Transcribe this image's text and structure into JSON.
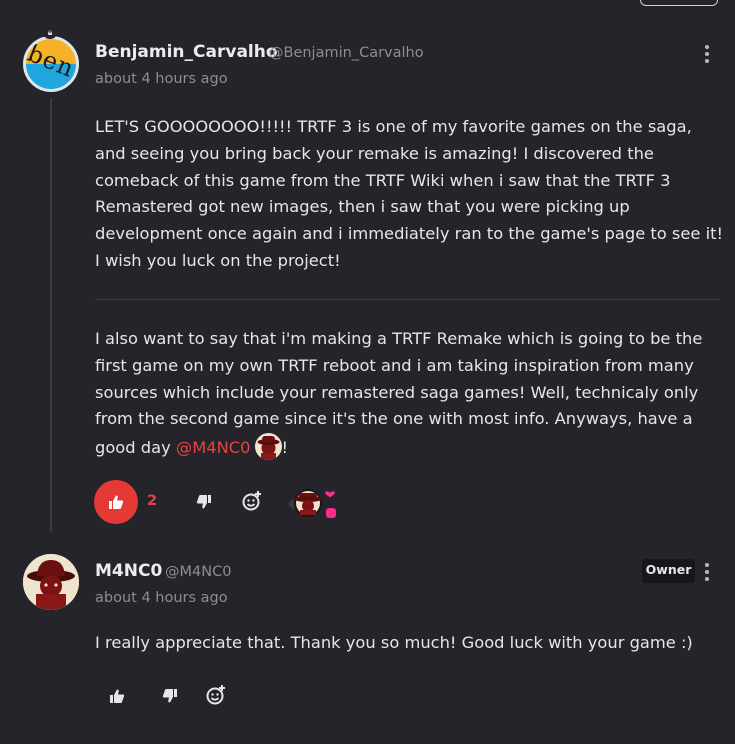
{
  "comment": {
    "username": "Benjamin_Carvalho",
    "handle": "@Benjamin_Carvalho",
    "time": "about 4 hours ago",
    "avatar_text": "ben",
    "paragraph1": "LET'S GOOOOOOOO!!!!! TRTF 3 is one of my favorite games on the saga, and seeing you bring back your remake is amazing! I discovered the comeback of this game from the TRTF Wiki when i saw that the TRTF 3 Remastered got new images, then i saw that you were picking up development once again and i immediately ran to the game's page to see it! I wish you luck on the project!",
    "paragraph2": "I also want to say that i'm making a TRTF Remake which is going to be the first game on my own TRTF reboot and i am taking inspiration from many sources which include your remastered saga games! Well, technicaly only from the second game since it's the one with most info. Anyways, have a good day",
    "mention": "@M4NC0",
    "paragraph2_end": "!",
    "like_count": "2",
    "like_active": true,
    "accent_color": "#e53935"
  },
  "reply": {
    "username": "M4NC0",
    "handle": "@M4NC0",
    "time": "about 4 hours ago",
    "badge": "Owner",
    "text": "I really appreciate that. Thank you so much! Good luck with your game :)"
  },
  "icons": [
    "thumbs-up-icon",
    "thumbs-down-icon",
    "add-reaction-icon",
    "more-options-icon",
    "heart-icon",
    "lock-icon"
  ]
}
